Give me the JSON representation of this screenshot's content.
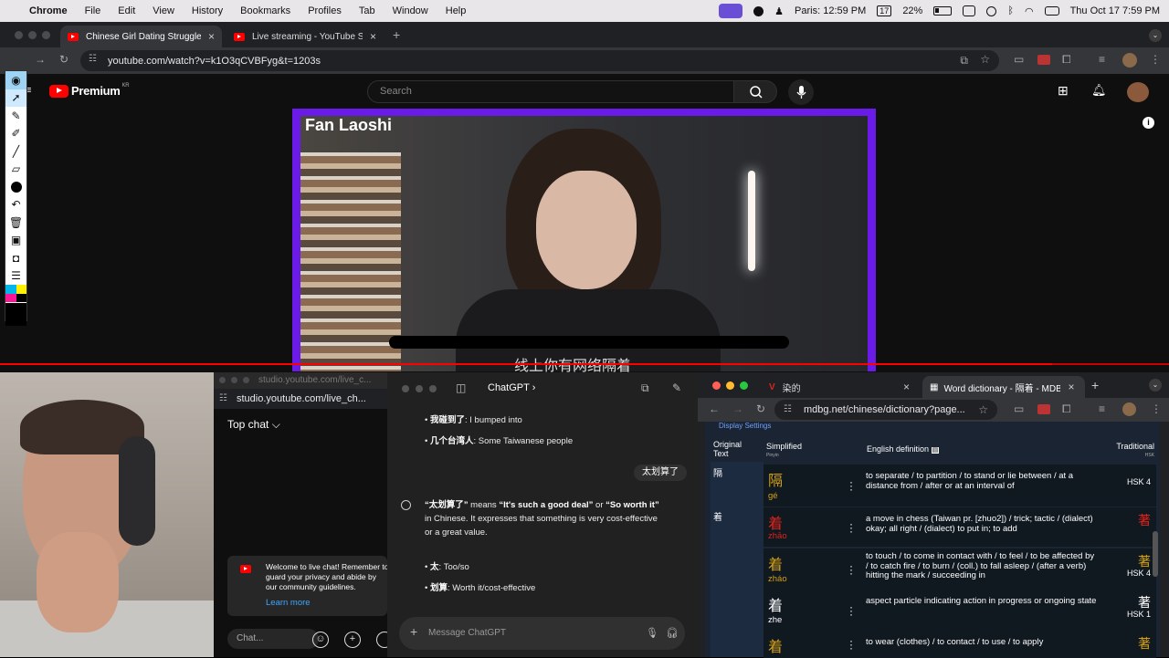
{
  "menubar": {
    "app": "Chrome",
    "items": [
      "File",
      "Edit",
      "View",
      "History",
      "Bookmarks",
      "Profiles",
      "Tab",
      "Window",
      "Help"
    ],
    "city_time": "Paris: 12:59 PM",
    "date_badge": "17",
    "battery": "22%",
    "datetime": "Thu Oct 17  7:59 PM"
  },
  "top_browser": {
    "tabs": [
      {
        "title": "Chinese Girl Dating Struggles",
        "active": true
      },
      {
        "title": "Live streaming - YouTube Stu",
        "active": false
      }
    ],
    "url": "youtube.com/watch?v=k1O3qCVBFyg&t=1203s"
  },
  "youtube": {
    "logo": "Premium",
    "region": "KR",
    "search_placeholder": "Search",
    "video_title_overlay": "Fan Laoshi",
    "caption": "线上你有网络隔着",
    "progress": 0.9
  },
  "annotation_tools": [
    "eye-icon",
    "cursor-icon",
    "lasso-icon",
    "pen-icon",
    "marker-icon",
    "eraser-icon",
    "dot-icon",
    "undo-icon",
    "trash-icon",
    "screen-icon",
    "camera-icon",
    "clipboard-icon",
    "color-icon",
    "black-icon"
  ],
  "studio": {
    "window_title": "studio.youtube.com/live_c...",
    "url": "studio.youtube.com/live_ch...",
    "top_chat": "Top chat",
    "notice": "Welcome to live chat! Remember to guard your privacy and abide by our community guidelines.",
    "learn_more": "Learn more",
    "chat_placeholder": "Chat..."
  },
  "chatgpt": {
    "title": "ChatGPT",
    "bullets_top": [
      {
        "term": "我碰到了",
        "meaning": ": I bumped into"
      },
      {
        "term": "几个台湾人",
        "meaning": ": Some Taiwanese people"
      }
    ],
    "user_message": "太划算了",
    "answer_term": "“太划算了”",
    "answer_mid": " means ",
    "answer_m1": "“It's such a good deal”",
    "answer_or": " or ",
    "answer_m2": "“So worth it”",
    "answer_rest": " in Chinese. It expresses that something is very cost-effective or a great value.",
    "bullets_bottom": [
      {
        "term": "太",
        "meaning": ": Too/so"
      },
      {
        "term": "划算",
        "meaning": ": Worth it/cost-effective"
      }
    ],
    "input_placeholder": "Message ChatGPT"
  },
  "mdbg": {
    "tabs": [
      {
        "title": "染的",
        "active": false
      },
      {
        "title": "Word dictionary - 隔着 - MDB",
        "active": true
      }
    ],
    "url": "mdbg.net/chinese/dictionary?page...",
    "display_settings": "Display Settings",
    "headers": {
      "original": "Original Text",
      "simplified": "Simplified",
      "pinyin": "Pinyin",
      "english": "English definition",
      "traditional": "Traditional",
      "hsk": "HSK"
    },
    "original_chars": [
      "隔",
      "着"
    ],
    "rows": [
      {
        "hanzi": "隔",
        "pinyin": "gé",
        "color": "#d4a017",
        "definition": "to separate / to partition / to stand or lie between / at a distance from / after or at an interval of",
        "trad": "",
        "hsk": "HSK 4",
        "light": false
      },
      {
        "hanzi": "着",
        "pinyin": "zhāo",
        "color": "#e0241b",
        "definition": "a move in chess (Taiwan pr. [zhuo2]) / trick; tactic / (dialect) okay; all right / (dialect) to put in; to add",
        "trad": "著",
        "hsk": "",
        "light": false
      },
      {
        "hanzi": "着",
        "pinyin": "zháo",
        "color": "#d4a017",
        "definition": "to touch / to come in contact with / to feel / to be affected by / to catch fire / to burn / (coll.) to fall asleep / (after a verb) hitting the mark / succeeding in",
        "trad": "著",
        "hsk": "HSK 4",
        "light": false
      },
      {
        "hanzi": "着",
        "pinyin": "zhe",
        "color": "#ffffff",
        "definition": "aspect particle indicating action in progress or ongoing state",
        "trad": "著",
        "hsk": "HSK 1",
        "light": false
      },
      {
        "hanzi": "着",
        "pinyin": "",
        "color": "#d4a017",
        "definition": "to wear (clothes) / to contact / to use / to apply",
        "trad": "著",
        "hsk": "",
        "light": false
      }
    ]
  }
}
